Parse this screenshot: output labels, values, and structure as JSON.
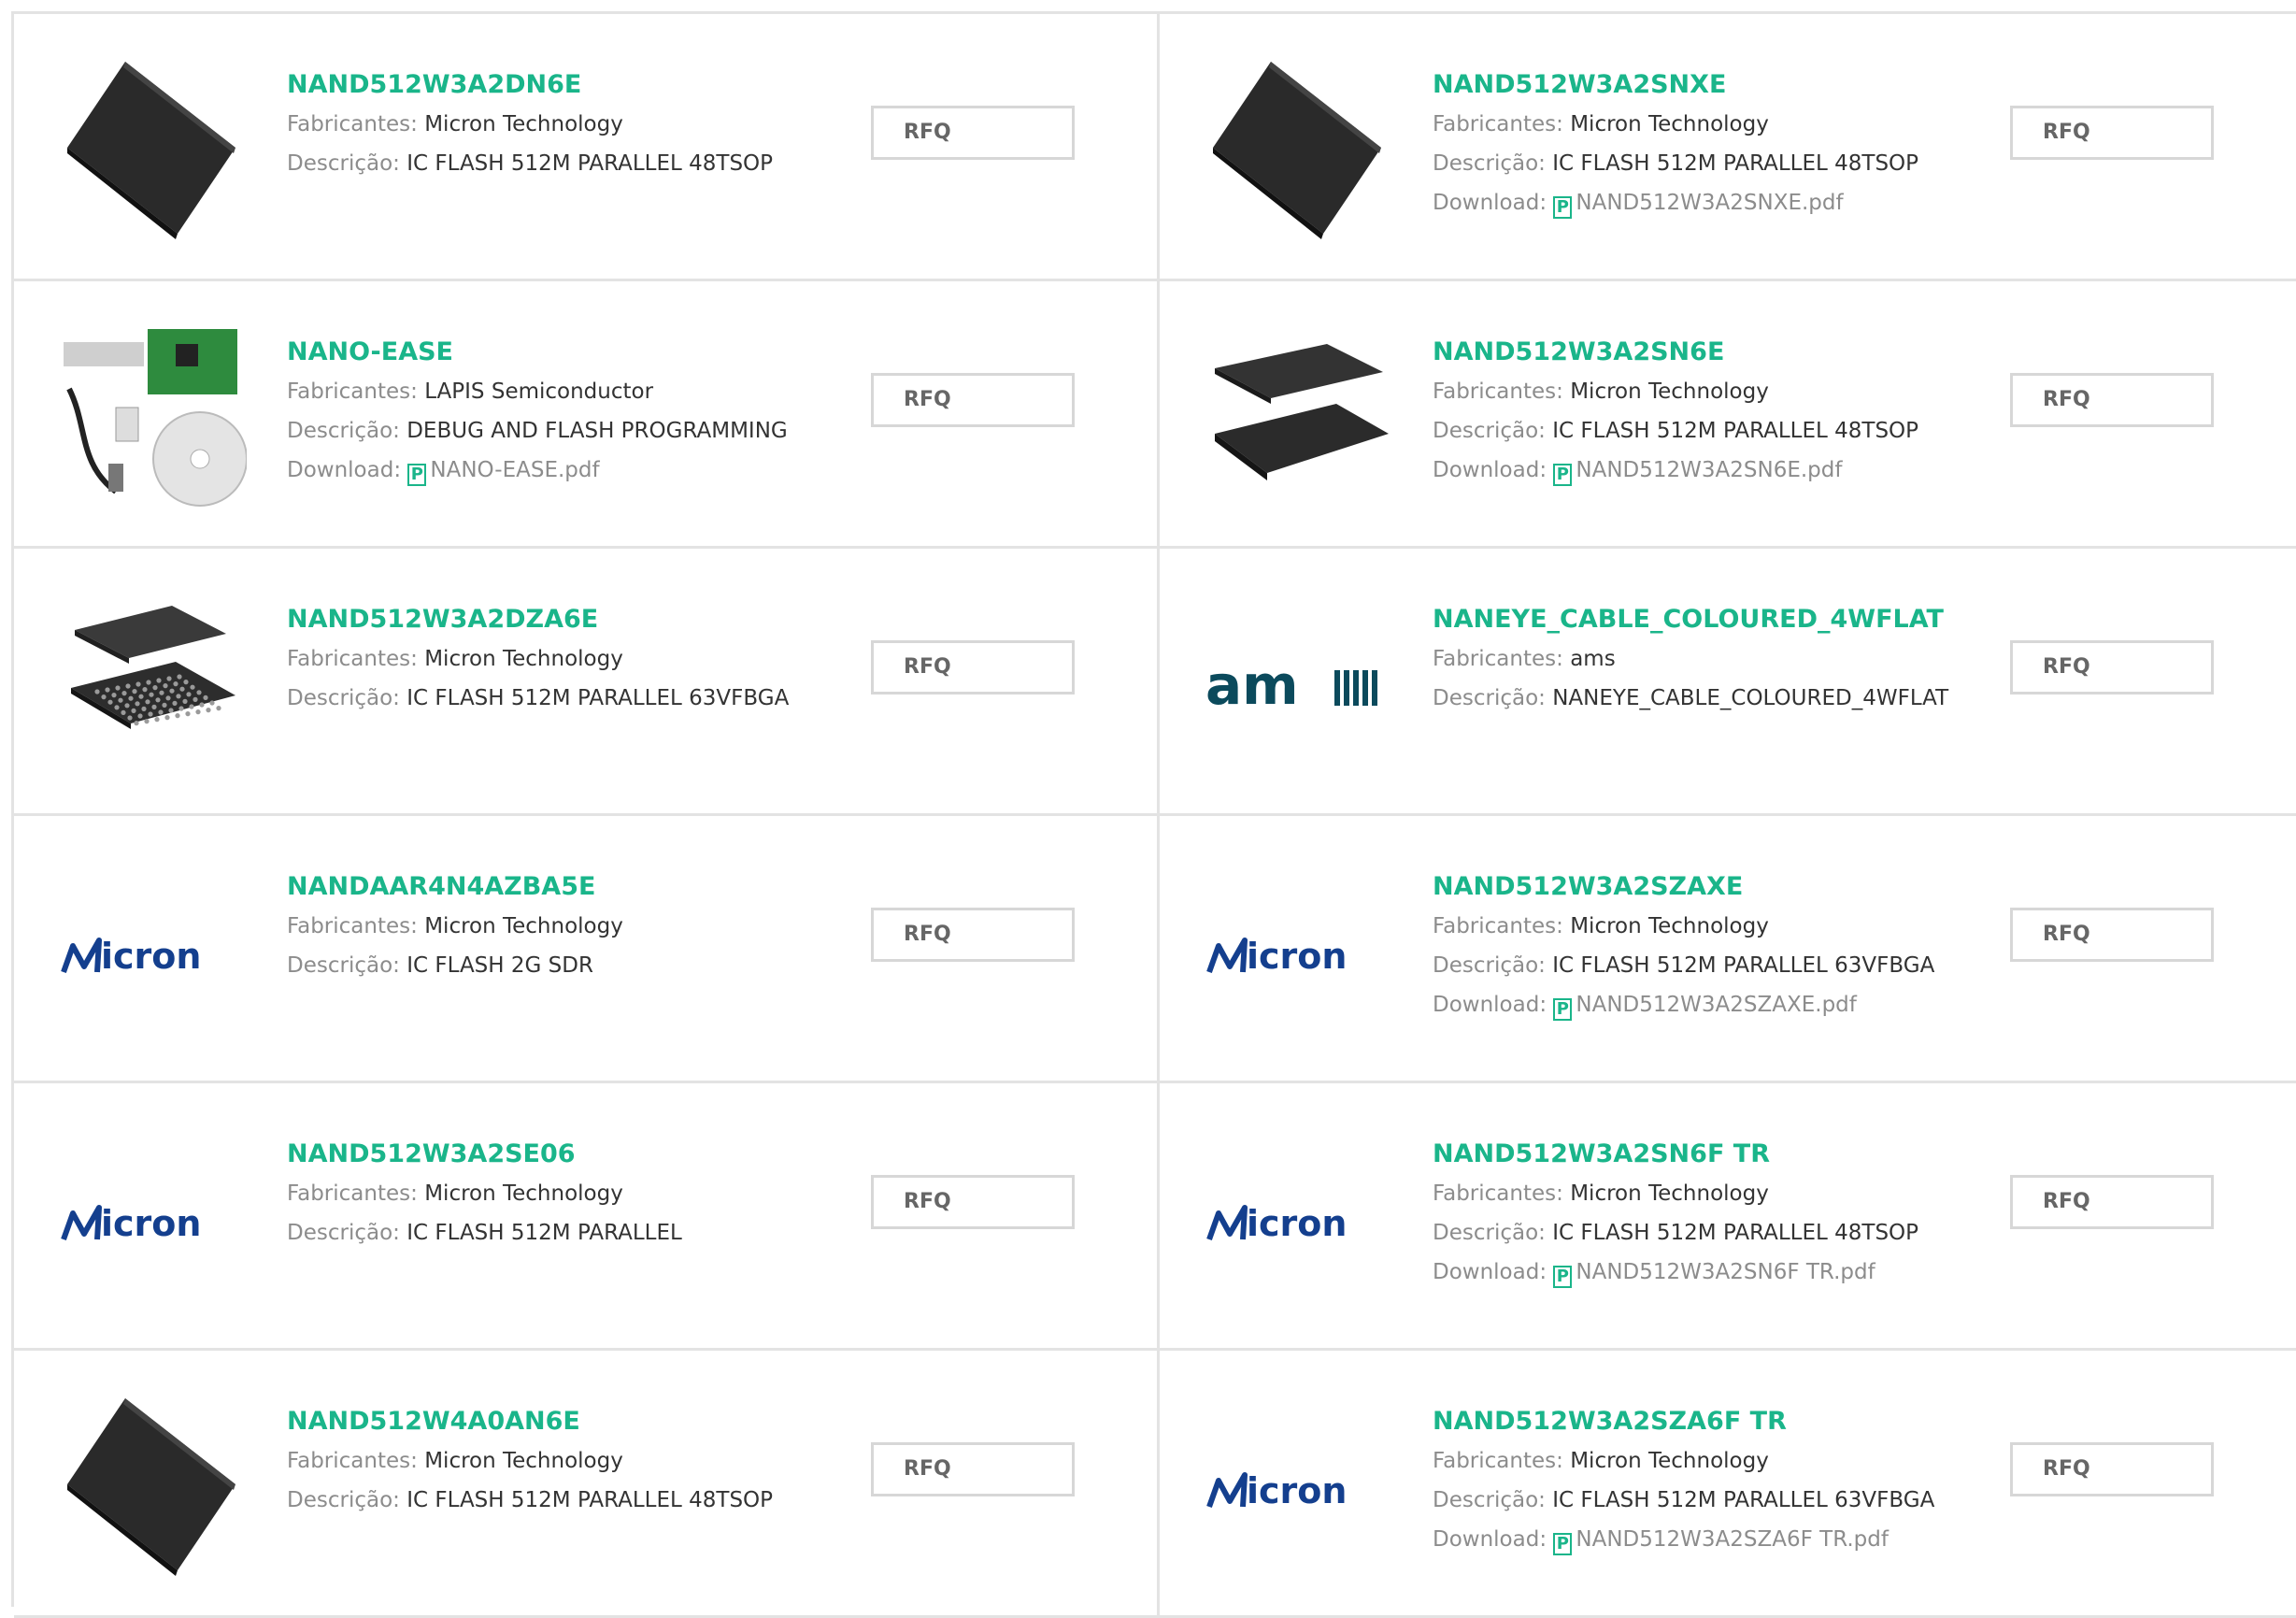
{
  "labels": {
    "manufacturer": "Fabricantes:",
    "description": "Descrição:",
    "download": "Download:"
  },
  "colors": {
    "accent": "#1ab58a",
    "border": "#e3e3e3",
    "micron_blue": "#143f8e",
    "ams_teal": "#0b4a5c"
  },
  "products": [
    {
      "part": "NAND512W3A2DN6E",
      "manufacturer": "Micron Technology",
      "description": "IC FLASH 512M PARALLEL 48TSOP",
      "download": "",
      "image": "tsop-chip-icon",
      "rfq": "RFQ"
    },
    {
      "part": "NAND512W3A2SNXE",
      "manufacturer": "Micron Technology",
      "description": "IC FLASH 512M PARALLEL 48TSOP",
      "download": "NAND512W3A2SNXE.pdf",
      "image": "tsop-chip-icon",
      "rfq": "RFQ"
    },
    {
      "part": "NANO-EASE",
      "manufacturer": "LAPIS Semiconductor",
      "description": "DEBUG AND FLASH PROGRAMMING",
      "download": "NANO-EASE.pdf",
      "image": "dev-kit-icon",
      "rfq": "RFQ"
    },
    {
      "part": "NAND512W3A2SN6E",
      "manufacturer": "Micron Technology",
      "description": "IC FLASH 512M PARALLEL 48TSOP",
      "download": "NAND512W3A2SN6E.pdf",
      "image": "tsop-pair-icon",
      "rfq": "RFQ"
    },
    {
      "part": "NAND512W3A2DZA6E",
      "manufacturer": "Micron Technology",
      "description": "IC FLASH 512M PARALLEL 63VFBGA",
      "download": "",
      "image": "bga-chip-icon",
      "rfq": "RFQ"
    },
    {
      "part": "NANEYE_CABLE_COLOURED_4WFLAT",
      "manufacturer": "ams",
      "description": "NANEYE_CABLE_COLOURED_4WFLAT",
      "download": "",
      "image": "ams-logo",
      "rfq": "RFQ"
    },
    {
      "part": "NANDAAR4N4AZBA5E",
      "manufacturer": "Micron Technology",
      "description": "IC FLASH 2G SDR",
      "download": "",
      "image": "micron-logo",
      "rfq": "RFQ"
    },
    {
      "part": "NAND512W3A2SZAXE",
      "manufacturer": "Micron Technology",
      "description": "IC FLASH 512M PARALLEL 63VFBGA",
      "download": "NAND512W3A2SZAXE.pdf",
      "image": "micron-logo",
      "rfq": "RFQ"
    },
    {
      "part": "NAND512W3A2SE06",
      "manufacturer": "Micron Technology",
      "description": "IC FLASH 512M PARALLEL",
      "download": "",
      "image": "micron-logo",
      "rfq": "RFQ"
    },
    {
      "part": "NAND512W3A2SN6F TR",
      "manufacturer": "Micron Technology",
      "description": "IC FLASH 512M PARALLEL 48TSOP",
      "download": "NAND512W3A2SN6F TR.pdf",
      "image": "micron-logo",
      "rfq": "RFQ"
    },
    {
      "part": "NAND512W4A0AN6E",
      "manufacturer": "Micron Technology",
      "description": "IC FLASH 512M PARALLEL 48TSOP",
      "download": "",
      "image": "tsop-chip-icon",
      "rfq": "RFQ"
    },
    {
      "part": "NAND512W3A2SZA6F TR",
      "manufacturer": "Micron Technology",
      "description": "IC FLASH 512M PARALLEL 63VFBGA",
      "download": "NAND512W3A2SZA6F TR.pdf",
      "image": "micron-logo",
      "rfq": "RFQ"
    }
  ]
}
